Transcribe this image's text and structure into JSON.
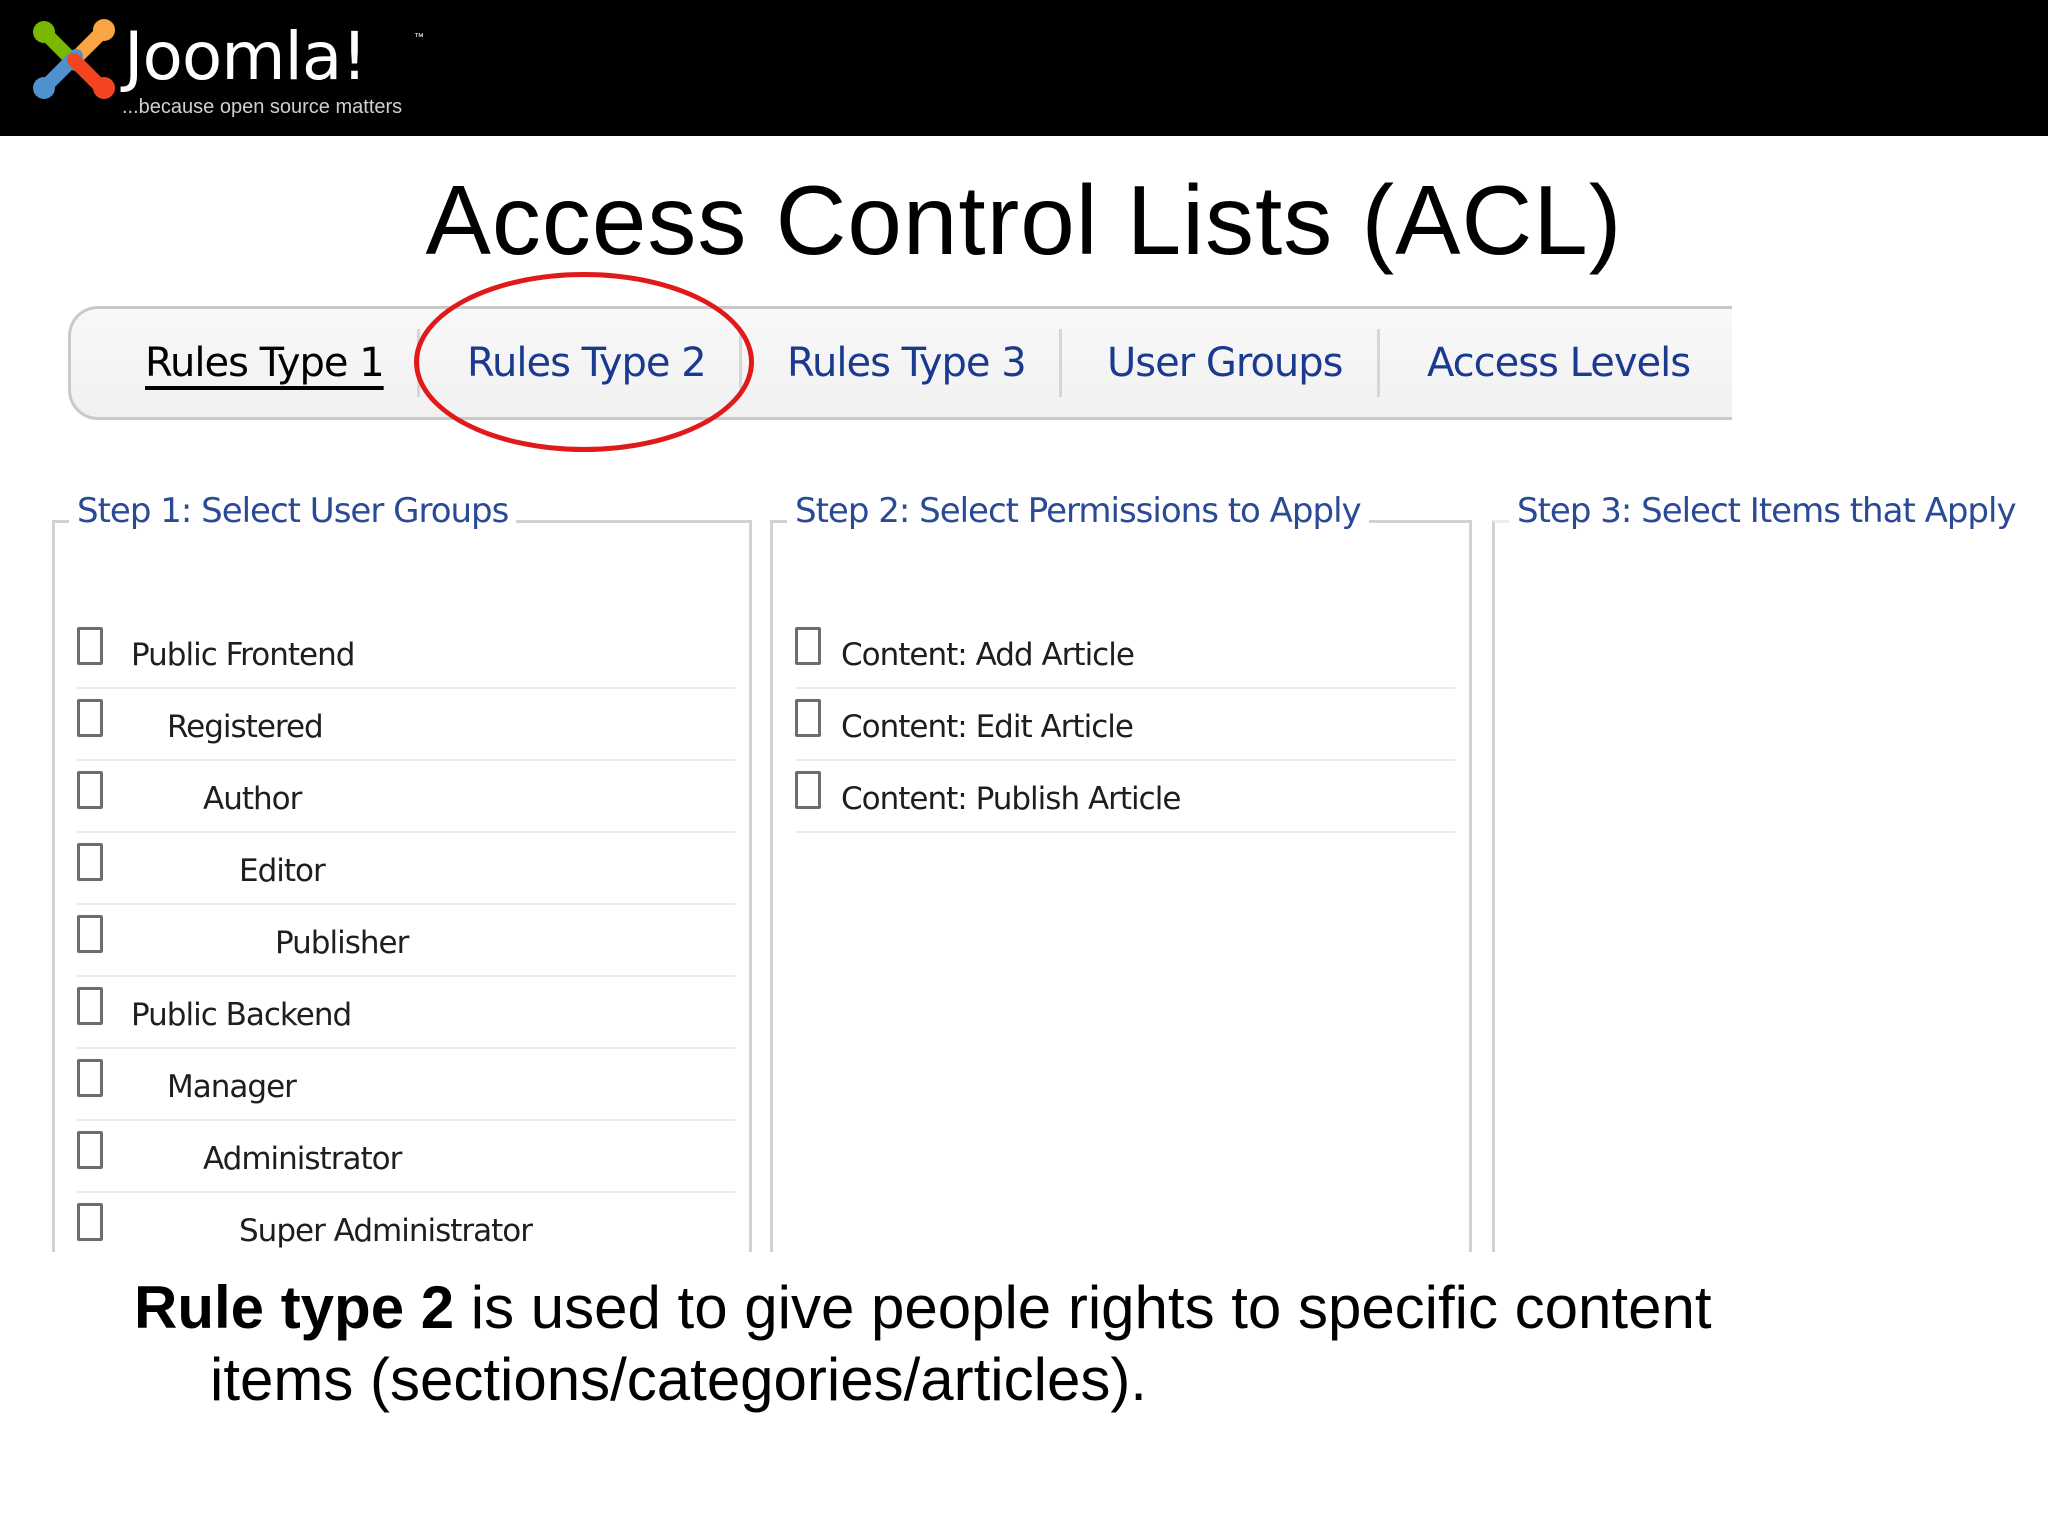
{
  "header": {
    "logo_word": "Joomla!",
    "logo_tm": "™",
    "tagline": "...because open source matters"
  },
  "slide": {
    "title": "Access Control Lists (ACL)"
  },
  "tabs": [
    {
      "label": "Rules Type 1",
      "active": true
    },
    {
      "label": "Rules Type 2",
      "active": false,
      "highlighted": true
    },
    {
      "label": "Rules Type 3",
      "active": false
    },
    {
      "label": "User Groups",
      "active": false
    },
    {
      "label": "Access Levels",
      "active": false
    }
  ],
  "colors": {
    "highlight_ring": "#e01a1a",
    "tab_link": "#1a3a8f",
    "legend": "#2a4a95"
  },
  "steps": {
    "step1": {
      "legend": "Step 1: Select User Groups",
      "groups": [
        {
          "label": "Public Frontend",
          "checked": false
        },
        {
          "label": "Registered",
          "checked": false
        },
        {
          "label": "Author",
          "checked": false
        },
        {
          "label": "Editor",
          "checked": false
        },
        {
          "label": "Publisher",
          "checked": false
        },
        {
          "label": "Public Backend",
          "checked": false
        },
        {
          "label": "Manager",
          "checked": false
        },
        {
          "label": "Administrator",
          "checked": false
        },
        {
          "label": "Super Administrator",
          "checked": false
        }
      ]
    },
    "step2": {
      "legend": "Step 2: Select Permissions to Apply",
      "permissions": [
        {
          "label": "Content: Add Article",
          "checked": false
        },
        {
          "label": "Content: Edit Article",
          "checked": false
        },
        {
          "label": "Content: Publish Article",
          "checked": false
        }
      ]
    },
    "step3": {
      "legend": "Step 3: Select Items that Apply"
    }
  },
  "caption": {
    "bold": "Rule type 2",
    "line1_rest": " is used to give people rights to specific content",
    "line2": "items (sections/categories/articles)."
  }
}
